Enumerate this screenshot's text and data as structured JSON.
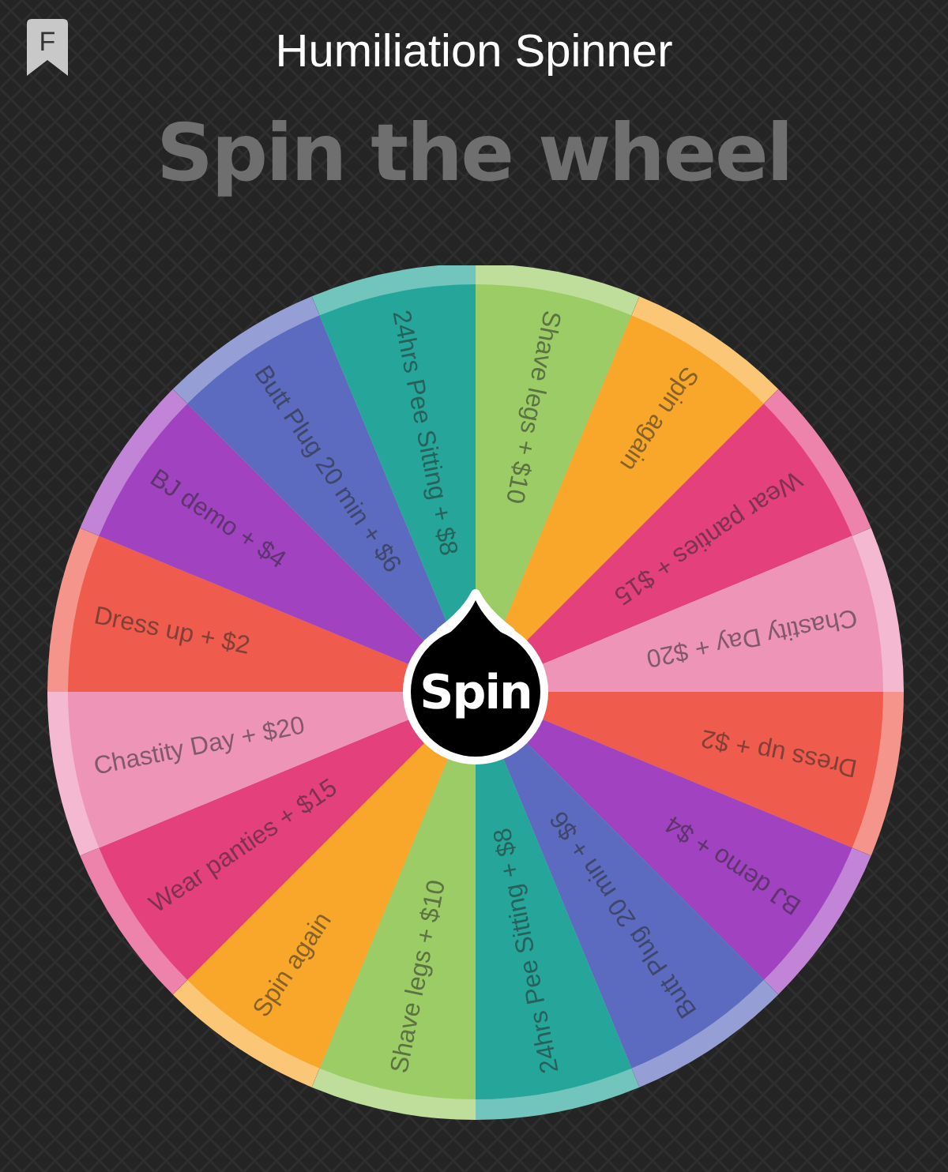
{
  "app_logo": {
    "letter": "F"
  },
  "title": "Humiliation Spinner",
  "heading": "Spin the wheel",
  "wheel": {
    "segments": [
      {
        "label": "Shave legs + $10",
        "color": "#9ccc65"
      },
      {
        "label": "Spin again",
        "color": "#f9a72b"
      },
      {
        "label": "Wear panties + $15",
        "color": "#e4407c"
      },
      {
        "label": "Chastity Day + $20",
        "color": "#ee94b6"
      },
      {
        "label": "Dress up + $2",
        "color": "#ef5b4c"
      },
      {
        "label": "BJ demo + $4",
        "color": "#a142c1"
      },
      {
        "label": "Butt Plug 20 min + $6",
        "color": "#5c6bc0"
      },
      {
        "label": "24hrs Pee Sitting + $8",
        "color": "#26a69a"
      },
      {
        "label": "Shave legs + $10",
        "color": "#9ccc65"
      },
      {
        "label": "Spin again",
        "color": "#f9a72b"
      },
      {
        "label": "Wear panties + $15",
        "color": "#e4407c"
      },
      {
        "label": "Chastity Day + $20",
        "color": "#ee94b6"
      },
      {
        "label": "Dress up + $2",
        "color": "#ef5b4c"
      },
      {
        "label": "BJ demo + $4",
        "color": "#a142c1"
      },
      {
        "label": "Butt Plug 20 min + $6",
        "color": "#5c6bc0"
      },
      {
        "label": "24hrs Pee Sitting + $8",
        "color": "#26a69a"
      }
    ],
    "spin_button": "Spin"
  }
}
